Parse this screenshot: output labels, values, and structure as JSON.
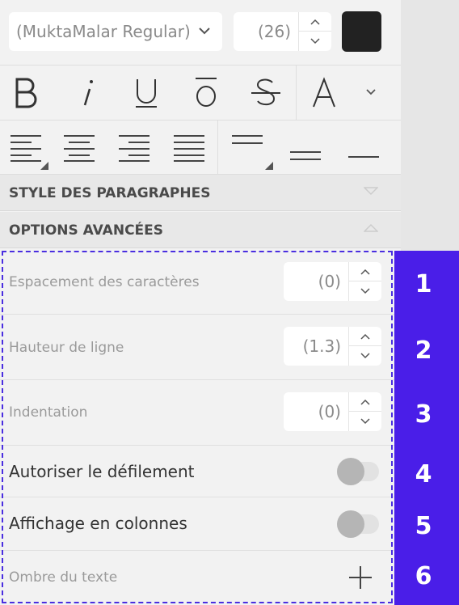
{
  "font": {
    "family": "(MuktaMalar Regular)",
    "size": "(26)",
    "color": "#222222"
  },
  "sections": {
    "paragraph_styles": "STYLE DES PARAGRAPHES",
    "advanced_options": "OPTIONS AVANCÉES"
  },
  "advanced": {
    "letter_spacing": {
      "label": "Espacement des caractères",
      "value": "(0)"
    },
    "line_height": {
      "label": "Hauteur de ligne",
      "value": "(1.3)"
    },
    "indent": {
      "label": "Indentation",
      "value": "(0)"
    },
    "scroll": {
      "label": "Autoriser le défilement"
    },
    "columns": {
      "label": "Affichage en colonnes"
    },
    "shadow": {
      "label": "Ombre du texte"
    }
  },
  "badges": [
    "1",
    "2",
    "3",
    "4",
    "5",
    "6"
  ],
  "colors": {
    "accent": "#4a1ee8",
    "panel": "#f2f2f2"
  }
}
